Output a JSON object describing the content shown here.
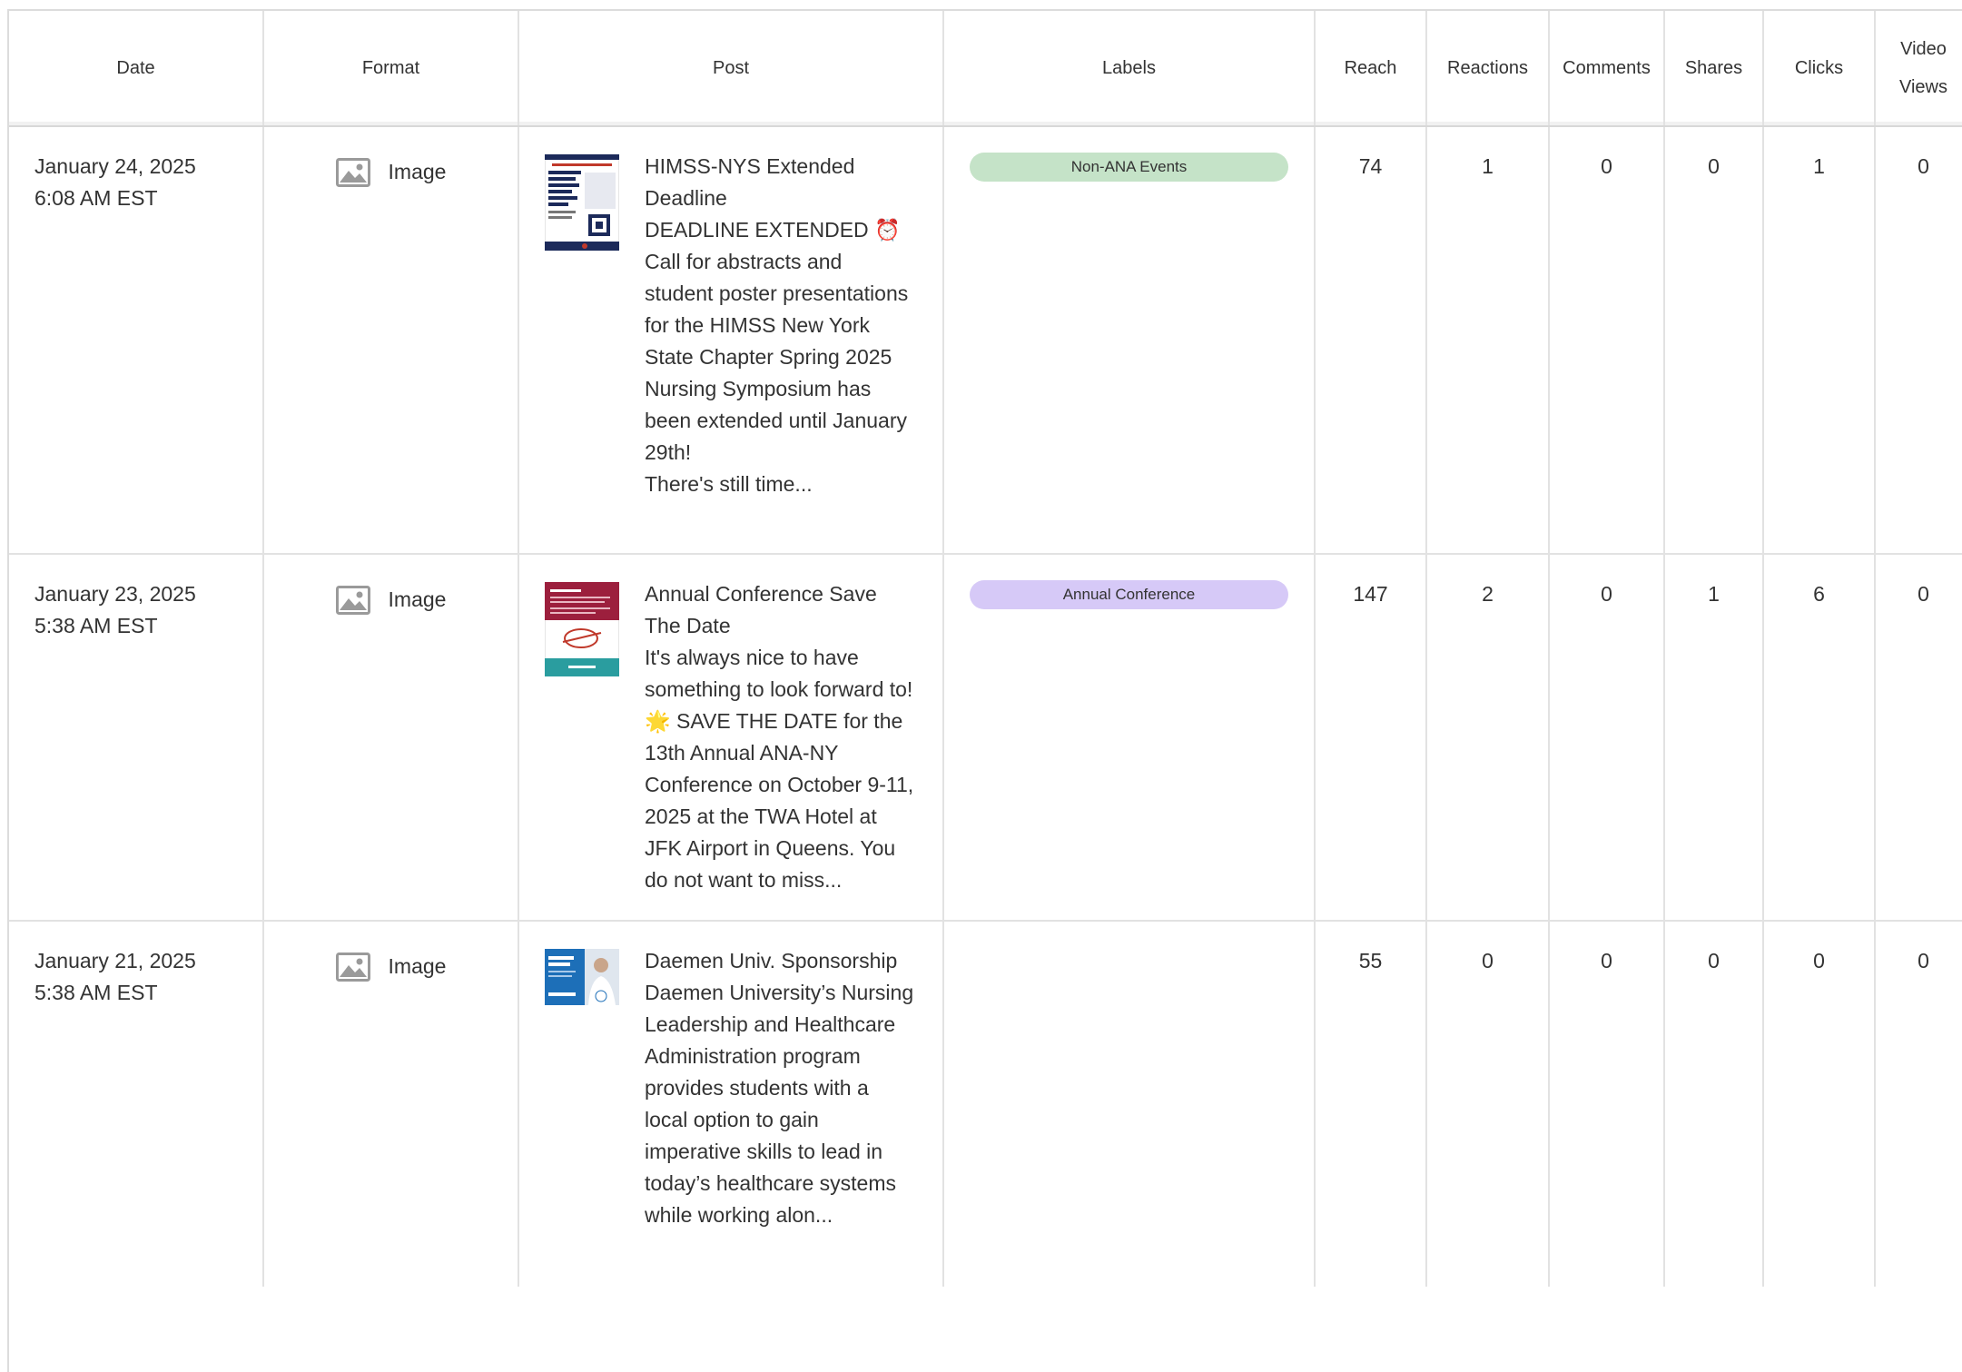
{
  "columns": [
    "Date",
    "Format",
    "Post",
    "Labels",
    "Reach",
    "Reactions",
    "Comments",
    "Shares",
    "Clicks",
    "Video Views"
  ],
  "label_colors": {
    "Non-ANA Events": "#c5e3c8",
    "Annual Conference": "#d6c9f7"
  },
  "rows": [
    {
      "date": "January 24, 2025",
      "time": "6:08 AM EST",
      "format": "Image",
      "format_icon": "image-icon",
      "thumbnail_icon": "post-flyer-thumbnail",
      "post": "HIMSS-NYS Extended Deadline\nDEADLINE EXTENDED ⏰\nCall for abstracts and student poster presentations for the HIMSS New York State Chapter Spring 2025 Nursing Symposium has been extended until January 29th!\nThere's still time...",
      "label": "Non-ANA Events",
      "reach": "74",
      "reactions": "1",
      "comments": "0",
      "shares": "0",
      "clicks": "1",
      "video_views": "0"
    },
    {
      "date": "January 23, 2025",
      "time": "5:38 AM EST",
      "format": "Image",
      "format_icon": "image-icon",
      "thumbnail_icon": "save-the-date-thumbnail",
      "post": "Annual Conference Save The Date\nIt's always nice to have something to look forward to! 🌟 SAVE THE DATE for the 13th Annual ANA-NY Conference on October 9-11, 2025 at the TWA Hotel at JFK Airport in Queens. You do not want to miss...",
      "label": "Annual Conference",
      "reach": "147",
      "reactions": "2",
      "comments": "0",
      "shares": "1",
      "clicks": "6",
      "video_views": "0"
    },
    {
      "date": "January 21, 2025",
      "time": "5:38 AM EST",
      "format": "Image",
      "format_icon": "image-icon",
      "thumbnail_icon": "daemen-thumbnail",
      "post": "Daemen Univ. Sponsorship\nDaemen University’s Nursing Leadership and Healthcare Administration program provides students with a local option to gain imperative skills to lead in today’s healthcare systems while working alon...",
      "label": "",
      "reach": "55",
      "reactions": "0",
      "comments": "0",
      "shares": "0",
      "clicks": "0",
      "video_views": "0"
    }
  ]
}
